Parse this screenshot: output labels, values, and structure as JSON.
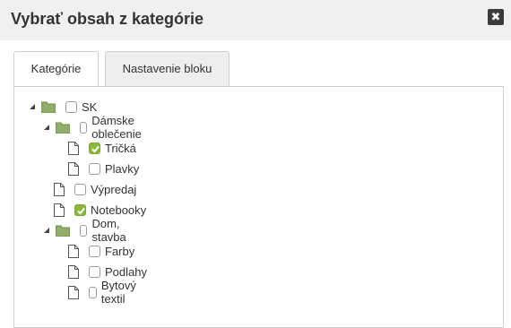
{
  "dialog": {
    "title": "Vybrať obsah z kategórie",
    "close_icon": "close-icon"
  },
  "tabs": [
    {
      "label": "Kategórie",
      "active": true
    },
    {
      "label": "Nastavenie bloku",
      "active": false
    }
  ],
  "tree": [
    {
      "label": "SK",
      "type": "folder",
      "expanded": true,
      "checked": false
    },
    {
      "label": "Dámske oblečenie",
      "type": "folder",
      "expanded": true,
      "checked": false
    },
    {
      "label": "Tričká",
      "type": "file",
      "checked": true
    },
    {
      "label": "Plavky",
      "type": "file",
      "checked": false
    },
    {
      "label": "Výpredaj",
      "type": "file",
      "checked": false
    },
    {
      "label": "Notebooky",
      "type": "file",
      "checked": true
    },
    {
      "label": "Dom, stavba",
      "type": "folder",
      "expanded": true,
      "checked": false
    },
    {
      "label": "Farby",
      "type": "file",
      "checked": false
    },
    {
      "label": "Podlahy",
      "type": "file",
      "checked": false
    },
    {
      "label": "Bytový textil",
      "type": "file",
      "checked": false
    }
  ],
  "colors": {
    "checkbox_checked": "#8cb83d",
    "folder": "#8fae6a",
    "header_bg": "#f0f0f0"
  }
}
